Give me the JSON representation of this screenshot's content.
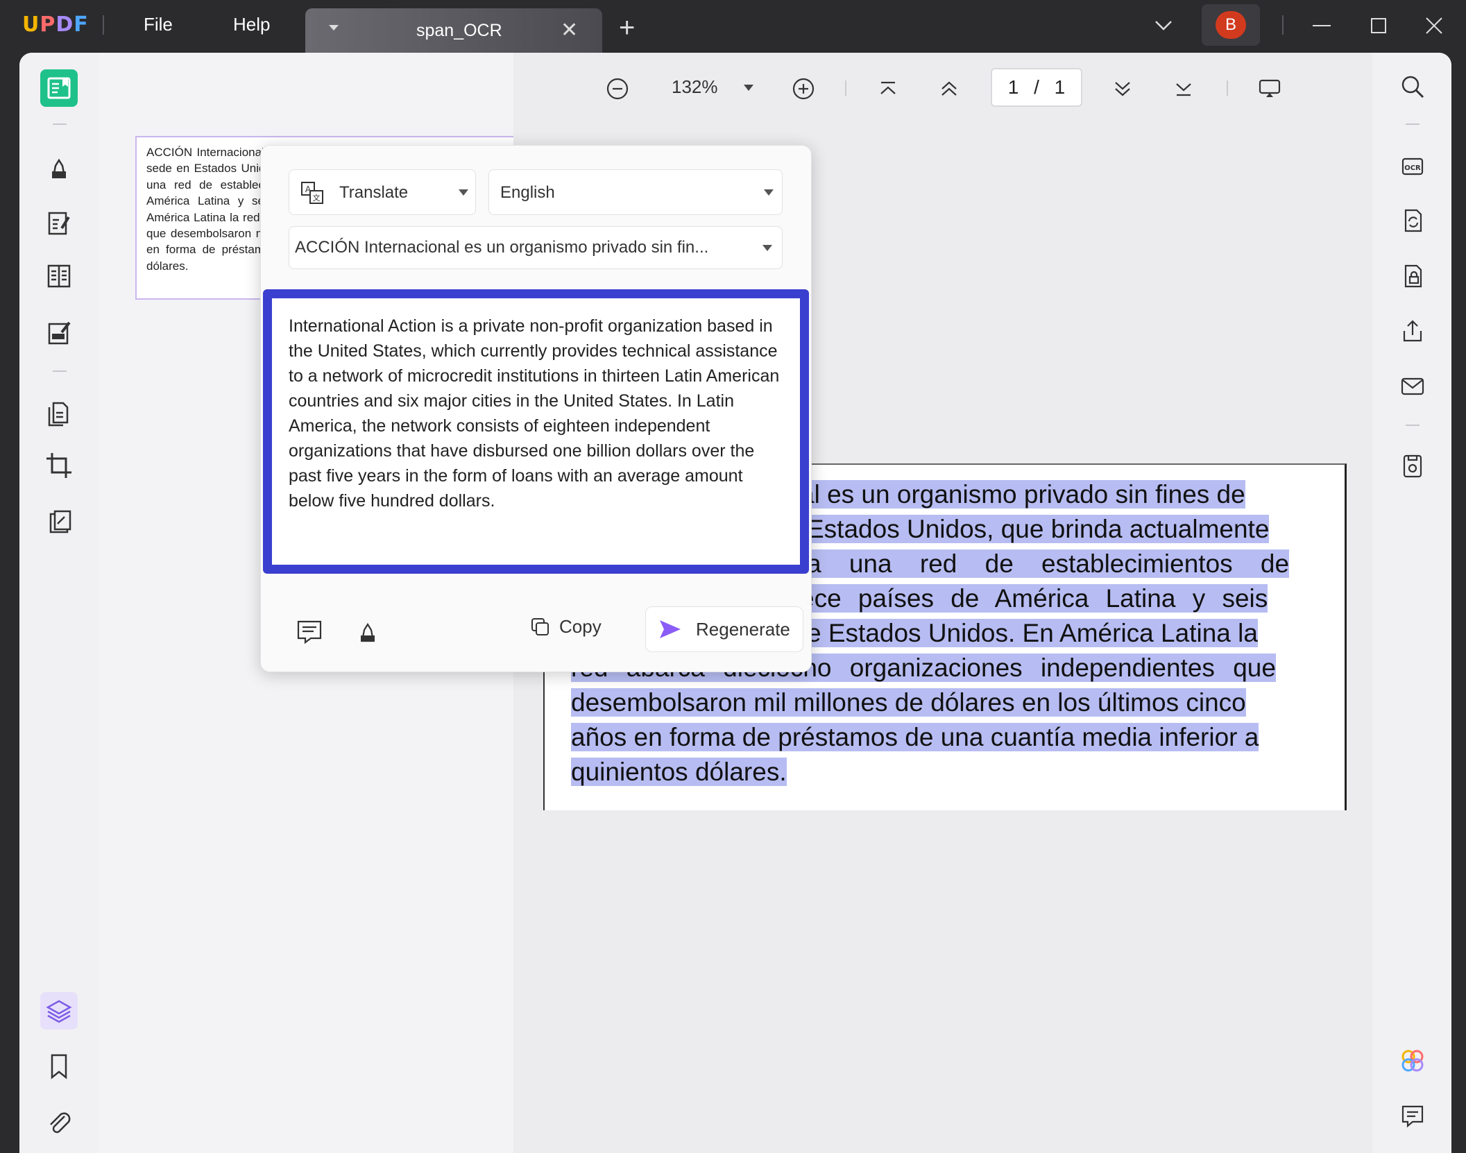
{
  "app": {
    "logo": "UPDF"
  },
  "menu": {
    "file": "File",
    "help": "Help"
  },
  "tab": {
    "title": "span_OCR",
    "close": "✕",
    "new": "+"
  },
  "user": {
    "initial": "B"
  },
  "toolbar": {
    "zoom": "132%",
    "page_current": "1",
    "page_sep": "/",
    "page_total": "1"
  },
  "thumbnail": {
    "text": "ACCIÓN Internacional es un organismo privado sin fines de lucro con sede en Estados Unidos, que brinda actualmente asistencia técnica a una red de establecimientos de microcrédito en trece países de América Latina y seis grandes ciudades de Estados Unidos. En América Latina la red abarca dieciocho organizaciones independientes que desembolsaron mil millones de dólares en los últimos cinco años en forma de préstamos de una cuantía media inferior a quinientos dólares."
  },
  "document": {
    "lines": [
      "al es un organismo privado sin fines de",
      "Estados Unidos, que brinda actualmente",
      "a una red de establecimientos de",
      "ece países de América Latina y seis",
      "e Estados Unidos. En América Latina la",
      "red abarca dieciocho organizaciones independientes que",
      "desembolsaron mil millones de dólares en los últimos cinco",
      "años en forma de préstamos de una cuantía media inferior a",
      "quinientos dólares."
    ]
  },
  "popup": {
    "mode": "Translate",
    "language": "English",
    "source_preview": "ACCIÓN Internacional es un organismo privado sin fin...",
    "result": "International Action is a private non-profit organization based in the United States, which currently provides technical assistance to a network of microcredit institutions in thirteen Latin American countries and six major cities in the United States. In Latin America, the network consists of eighteen independent organizations that have disbursed one billion dollars over the past five years in the form of loans with an average amount below five hundred dollars.",
    "copy": "Copy",
    "regenerate": "Regenerate"
  },
  "colors": {
    "accent": "#3b3fcf",
    "highlight": "#b7bdf2",
    "active_tool": "#1fc18a",
    "avatar": "#d23a1e"
  }
}
